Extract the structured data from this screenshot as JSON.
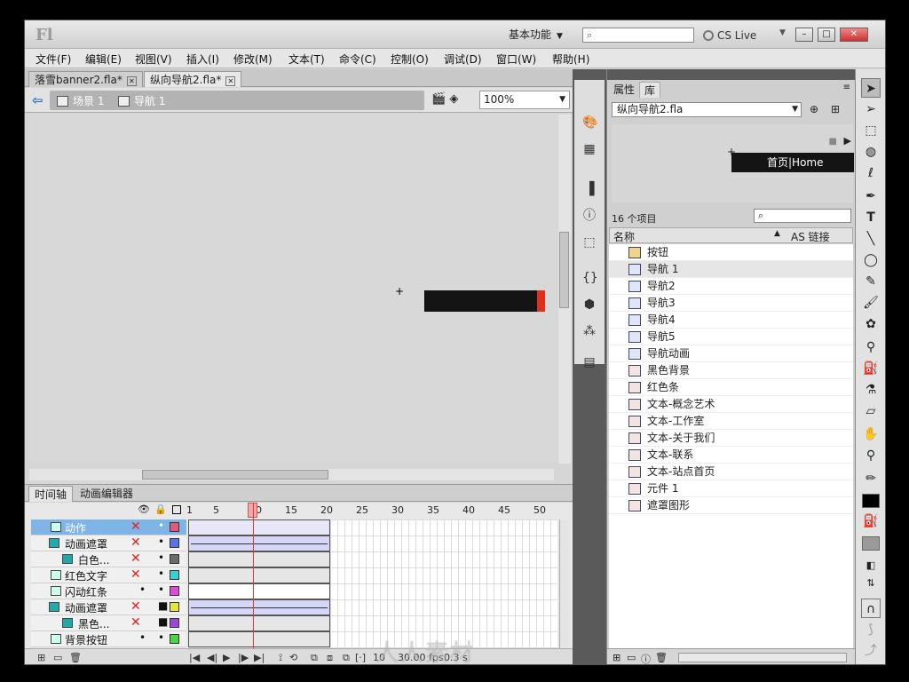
{
  "app": {
    "logo": "Fl",
    "workspace": "基本功能",
    "cs_live": "CS Live"
  },
  "window_buttons": {
    "minimize": "–",
    "maximize": "□",
    "close": "✕"
  },
  "menu": [
    "文件(F)",
    "编辑(E)",
    "视图(V)",
    "插入(I)",
    "修改(M)",
    "文本(T)",
    "命令(C)",
    "控制(O)",
    "调试(D)",
    "窗口(W)",
    "帮助(H)"
  ],
  "doc_tabs": [
    {
      "label": "落雪banner2.fla*",
      "active": false
    },
    {
      "label": "纵向导航2.fla*",
      "active": true
    }
  ],
  "breadcrumb": {
    "scene": "场景 1",
    "symbol": "导航 1"
  },
  "zoom": "100%",
  "timeline": {
    "tabs": [
      "时间轴",
      "动画编辑器"
    ],
    "frame_numbers": [
      "1",
      "5",
      "10",
      "15",
      "20",
      "25",
      "30",
      "35",
      "40",
      "45",
      "50"
    ],
    "current_frame": "10",
    "layers": [
      {
        "name": "动作",
        "selected": true,
        "color": "#e05a7a"
      },
      {
        "name": "动画遮罩",
        "selected": false,
        "color": "#5a72e6"
      },
      {
        "name": "白色...",
        "selected": false,
        "color": "#6b6b6b"
      },
      {
        "name": "红色文字",
        "selected": false,
        "color": "#38d0d0"
      },
      {
        "name": "闪动红条",
        "selected": false,
        "color": "#e04ad8"
      },
      {
        "name": "动画遮罩",
        "selected": false,
        "color": "#e6e63a"
      },
      {
        "name": "黑色...",
        "selected": false,
        "color": "#9a48d6"
      },
      {
        "name": "背景按钮",
        "selected": false,
        "color": "#48d648"
      }
    ],
    "status": {
      "frame": "10",
      "fps": "30.00 fps",
      "time": "0.3 s"
    }
  },
  "library": {
    "tabs": [
      "属性",
      "库"
    ],
    "file": "纵向导航2.fla",
    "preview_text": "首页|Home",
    "count": "16 个项目",
    "columns": {
      "name": "名称",
      "linkage": "AS 链接"
    },
    "items": [
      {
        "name": "按钮",
        "type": "folder"
      },
      {
        "name": "导航 1",
        "type": "movieclip",
        "selected": true
      },
      {
        "name": "导航2",
        "type": "movieclip"
      },
      {
        "name": "导航3",
        "type": "movieclip"
      },
      {
        "name": "导航4",
        "type": "movieclip"
      },
      {
        "name": "导航5",
        "type": "movieclip"
      },
      {
        "name": "导航动画",
        "type": "movieclip"
      },
      {
        "name": "黑色背景",
        "type": "graphic"
      },
      {
        "name": "红色条",
        "type": "graphic"
      },
      {
        "name": "文本-概念艺术",
        "type": "graphic"
      },
      {
        "name": "文本-工作室",
        "type": "graphic"
      },
      {
        "name": "文本-关于我们",
        "type": "graphic"
      },
      {
        "name": "文本-联系",
        "type": "graphic"
      },
      {
        "name": "文本-站点首页",
        "type": "graphic"
      },
      {
        "name": "元件 1",
        "type": "graphic"
      },
      {
        "name": "遮罩图形",
        "type": "graphic"
      }
    ]
  },
  "watermark": "人人素材",
  "colors": {
    "stage_bg": "#d8d8d8",
    "bar_black": "#141414",
    "bar_red": "#e0301a",
    "selection": "#7fb4e6"
  }
}
